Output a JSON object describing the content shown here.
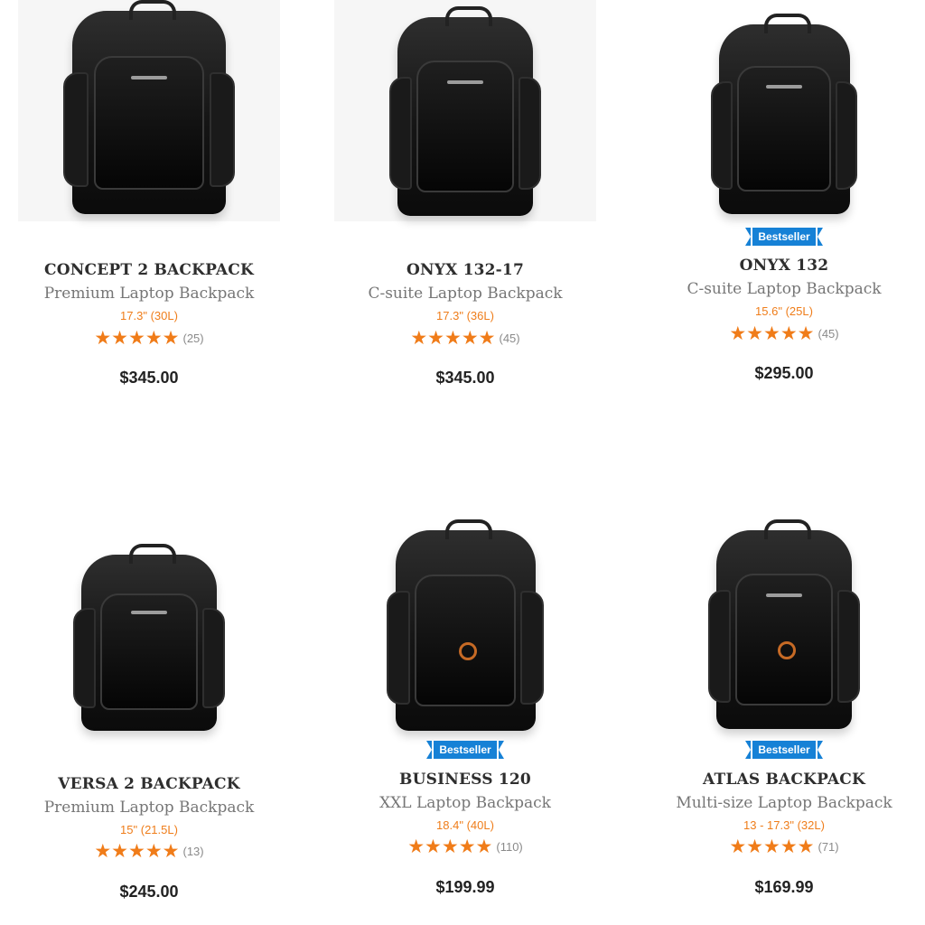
{
  "products": [
    {
      "name": "CONCEPT 2 BACKPACK",
      "subtitle": "Premium Laptop Backpack",
      "size": "17.3\" (30L)",
      "stars": "★★★★★",
      "reviews": "(25)",
      "price": "$345.00",
      "badge": ""
    },
    {
      "name": "ONYX 132-17",
      "subtitle": "C-suite Laptop Backpack",
      "size": "17.3\" (36L)",
      "stars": "★★★★★",
      "reviews": "(45)",
      "price": "$345.00",
      "badge": ""
    },
    {
      "name": "ONYX 132",
      "subtitle": "C-suite Laptop Backpack",
      "size": "15.6\" (25L)",
      "stars": "★★★★★",
      "reviews": "(45)",
      "price": "$295.00",
      "badge": "Bestseller"
    },
    {
      "name": "VERSA 2 BACKPACK",
      "subtitle": "Premium Laptop Backpack",
      "size": "15\" (21.5L)",
      "stars": "★★★★★",
      "reviews": "(13)",
      "price": "$245.00",
      "badge": ""
    },
    {
      "name": "BUSINESS 120",
      "subtitle": "XXL Laptop Backpack",
      "size": "18.4\" (40L)",
      "stars": "★★★★★",
      "reviews": "(110)",
      "price": "$199.99",
      "badge": "Bestseller"
    },
    {
      "name": "ATLAS BACKPACK",
      "subtitle": "Multi-size Laptop Backpack",
      "size": "13 - 17.3\" (32L)",
      "stars": "★★★★★",
      "reviews": "(71)",
      "price": "$169.99",
      "badge": "Bestseller"
    }
  ],
  "ratings": [
    5,
    5,
    5,
    5,
    5,
    5
  ],
  "colors": {
    "accent": "#ef7d1a",
    "badge": "#1681d6",
    "title": "#2e2e2e",
    "subtitle": "#767676"
  }
}
